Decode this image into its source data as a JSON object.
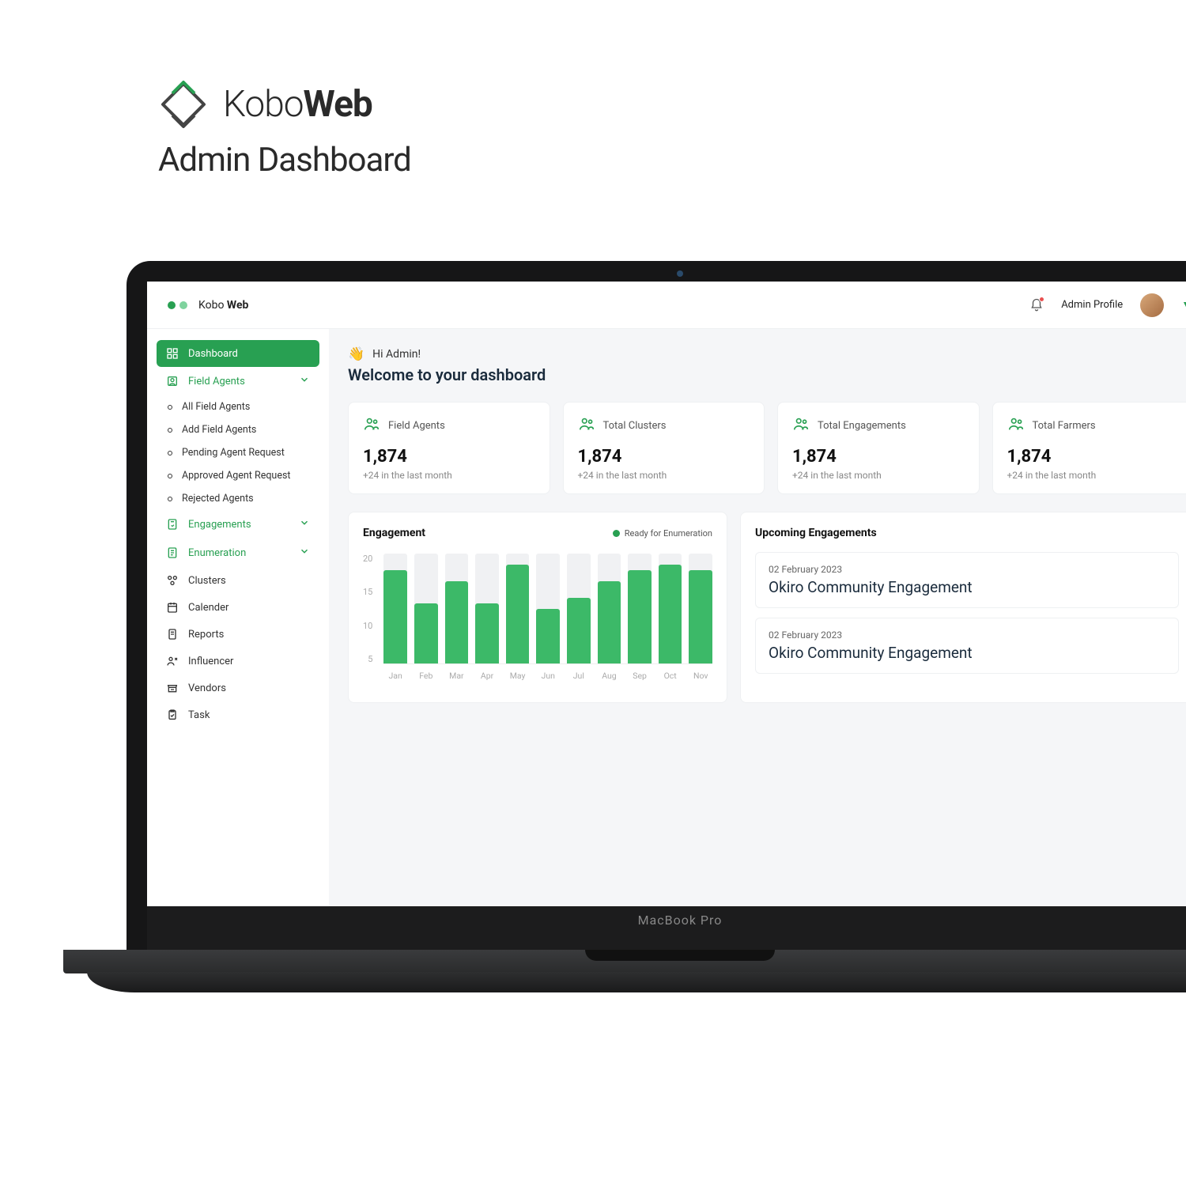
{
  "hero": {
    "brand_light": "Kobo",
    "brand_bold": "Web",
    "subtitle": "Admin Dashboard"
  },
  "topbar": {
    "brand_light": "Kobo ",
    "brand_bold": "Web",
    "profile_label": "Admin Profile"
  },
  "sidebar": {
    "dashboard": "Dashboard",
    "field_agents": "Field Agents",
    "fa_sub": [
      "All Field Agents",
      "Add Field Agents",
      "Pending Agent Request",
      "Approved Agent Request",
      "Rejected Agents"
    ],
    "engagements": "Engagements",
    "enumeration": "Enumeration",
    "clusters": "Clusters",
    "calendar": "Calender",
    "reports": "Reports",
    "influencer": "Influencer",
    "vendors": "Vendors",
    "task": "Task"
  },
  "main": {
    "greet": "Hi Admin!",
    "welcome": "Welcome to your dashboard"
  },
  "cards": [
    {
      "title": "Field Agents",
      "value": "1,874",
      "delta": "+24 in the last month"
    },
    {
      "title": "Total Clusters",
      "value": "1,874",
      "delta": "+24 in the last month"
    },
    {
      "title": "Total Engagements",
      "value": "1,874",
      "delta": "+24 in the last month"
    },
    {
      "title": "Total Farmers",
      "value": "1,874",
      "delta": "+24 in the last month"
    }
  ],
  "chart_panel": {
    "title": "Engagement",
    "legend": "Ready for Enumeration"
  },
  "chart_data": {
    "type": "bar",
    "categories": [
      "Jan",
      "Feb",
      "Mar",
      "Apr",
      "May",
      "Jun",
      "Jul",
      "Aug",
      "Sep",
      "Oct",
      "Nov"
    ],
    "values": [
      17,
      11,
      15,
      11,
      18,
      10,
      12,
      15,
      17,
      18,
      17
    ],
    "title": "Engagement",
    "xlabel": "",
    "ylabel": "",
    "ylim": [
      0,
      20
    ],
    "yticks": [
      20,
      15,
      10,
      5
    ],
    "legend": "Ready for Enumeration"
  },
  "upcoming": {
    "title": "Upcoming Engagements",
    "items": [
      {
        "date": "02 February 2023",
        "title": "Okiro Community Engagement"
      },
      {
        "date": "02 February 2023",
        "title": "Okiro Community Engagement"
      }
    ]
  },
  "laptop_label": "MacBook Pro"
}
